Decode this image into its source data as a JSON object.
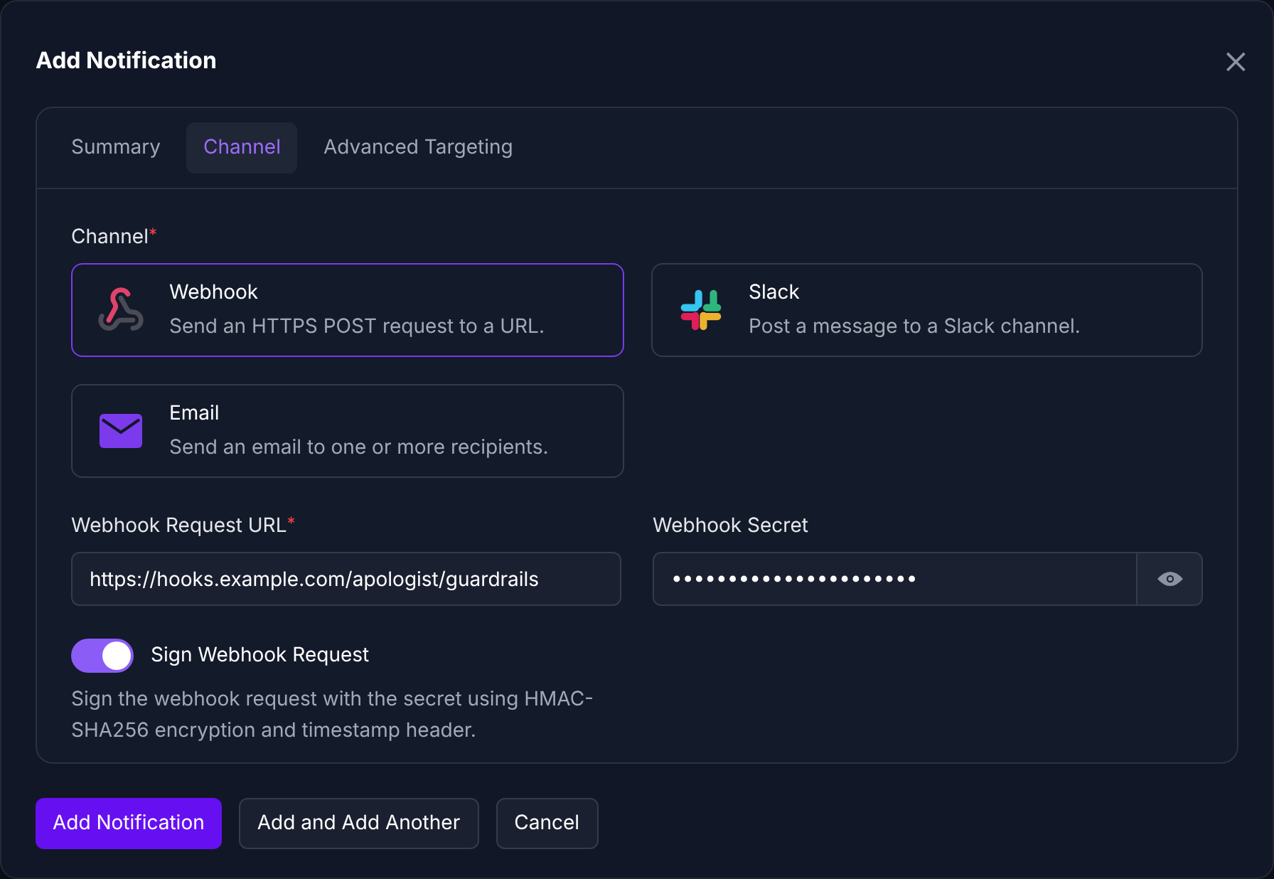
{
  "dialog": {
    "title": "Add Notification",
    "close": "×"
  },
  "tabs": [
    {
      "label": "Summary",
      "selected": false
    },
    {
      "label": "Channel",
      "selected": true
    },
    {
      "label": "Advanced Targeting",
      "selected": false
    }
  ],
  "channel_label": "Channel",
  "channel_required": "*",
  "channels": [
    {
      "kind": "webhook",
      "name": "Webhook",
      "description": "Send an HTTPS POST request to a URL.",
      "selected": true
    },
    {
      "kind": "slack",
      "name": "Slack",
      "description": "Post a message to a Slack channel.",
      "selected": false
    },
    {
      "kind": "email",
      "name": "Email",
      "description": "Send an email to one or more recipients.",
      "selected": false
    }
  ],
  "url_field": {
    "label": "Webhook Request URL",
    "required": "*",
    "value": "https://hooks.example.com/apologist/guardrails"
  },
  "secret_field": {
    "label": "Webhook Secret",
    "value": "••••••••••••••••••••••"
  },
  "sign_toggle": {
    "label": "Sign Webhook Request",
    "on": true,
    "description": "Sign the webhook request with the secret using HMAC-SHA256 encryption and timestamp header."
  },
  "buttons": [
    {
      "label": "Add Notification",
      "kind": "primary"
    },
    {
      "label": "Add and Add Another",
      "kind": "secondary"
    },
    {
      "label": "Cancel",
      "kind": "secondary"
    }
  ]
}
